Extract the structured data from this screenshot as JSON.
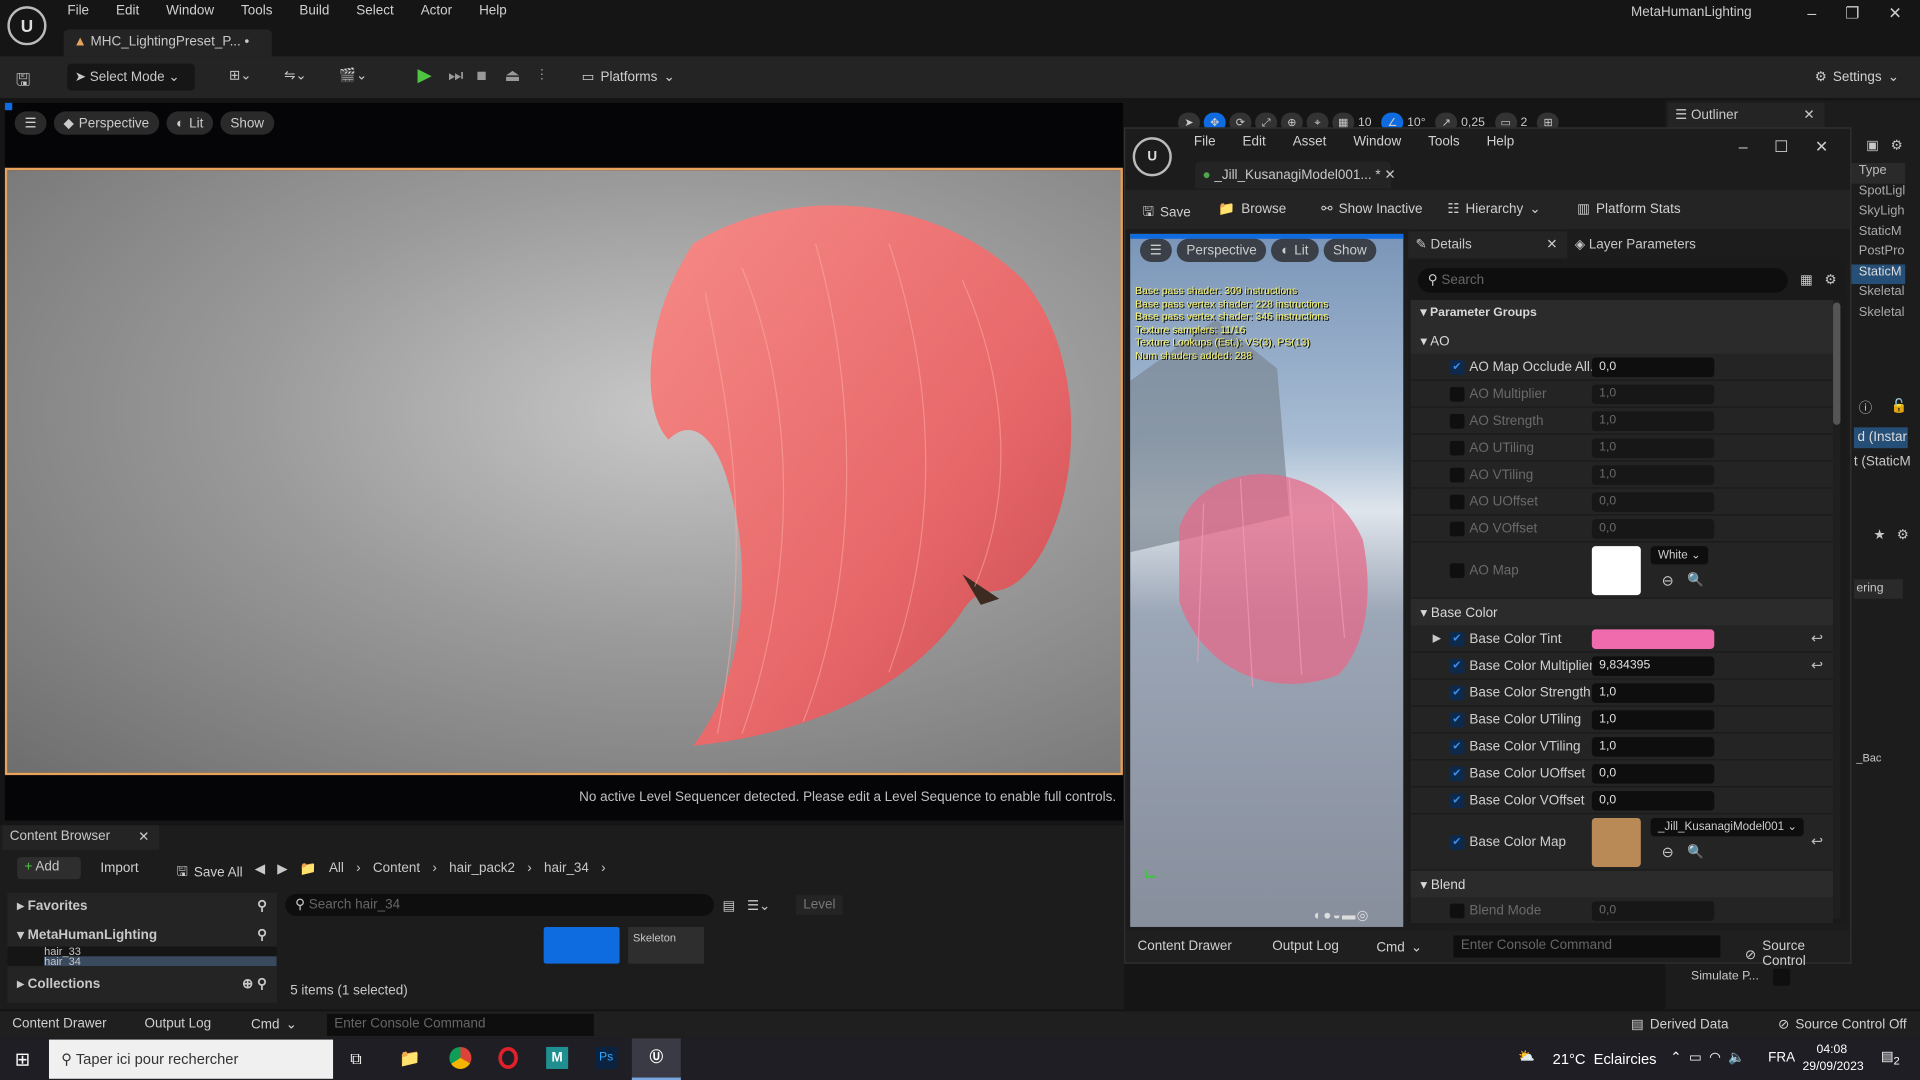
{
  "app": {
    "menus": [
      "File",
      "Edit",
      "Window",
      "Tools",
      "Build",
      "Select",
      "Actor",
      "Help"
    ],
    "project": "MetaHumanLighting",
    "tab": "MHC_LightingPreset_P...",
    "tab_modified": "•"
  },
  "toolbar": {
    "select_mode": "Select Mode",
    "platforms": "Platforms",
    "settings": "Settings"
  },
  "viewport": {
    "perspective": "Perspective",
    "lit": "Lit",
    "show": "Show",
    "grid": "10",
    "angle": "10°",
    "scale": "0,25",
    "camera": "2",
    "sequencer_msg": "No active Level Sequencer detected. Please edit a Level Sequence to enable full controls."
  },
  "outliner": {
    "title": "Outliner",
    "type_header": "Type",
    "types": [
      "SpotLigl",
      "SkyLigh",
      "StaticM",
      "PostPro",
      "StaticM",
      "Skeletal",
      "Skeletal"
    ],
    "selected_index": 4,
    "details_lines": [
      "d (Instar",
      "t (StaticM"
    ],
    "filter": "ering",
    "simulate": "Simulate P...",
    "map_value": "_Bac"
  },
  "editor": {
    "menus": [
      "File",
      "Edit",
      "Asset",
      "Window",
      "Tools",
      "Help"
    ],
    "tab": "_Jill_KusanagiModel001...",
    "tab_modified": "*",
    "save": "Save",
    "browse": "Browse",
    "show_inactive": "Show Inactive",
    "hierarchy": "Hierarchy",
    "platform_stats": "Platform Stats",
    "preview": {
      "perspective": "Perspective",
      "lit": "Lit",
      "show": "Show",
      "stats": [
        "Base pass shader: 309 instructions",
        "Base pass vertex shader: 228 instructions",
        "Base pass vertex shader: 346 instructions",
        "Texture samplers: 11/16",
        "Texture Lookups (Est.): VS(3), PS(13)",
        "Num shaders added: 288"
      ]
    },
    "details_tab": "Details",
    "layer_tab": "Layer Parameters",
    "search_placeholder": "Search",
    "param_groups": "Parameter Groups",
    "groups": [
      {
        "name": "AO",
        "rows": [
          {
            "label": "AO Map Occlude All...",
            "value": "0,0",
            "checked": true,
            "fill": 0
          },
          {
            "label": "AO Multiplier",
            "value": "1,0",
            "checked": false,
            "fill": 0
          },
          {
            "label": "AO Strength",
            "value": "1,0",
            "checked": false,
            "fill": 0
          },
          {
            "label": "AO UTiling",
            "value": "1,0",
            "checked": false,
            "fill": 0
          },
          {
            "label": "AO VTiling",
            "value": "1,0",
            "checked": false,
            "fill": 0
          },
          {
            "label": "AO UOffset",
            "value": "0,0",
            "checked": false,
            "fill": 0.5
          },
          {
            "label": "AO VOffset",
            "value": "0,0",
            "checked": false,
            "fill": 0.5
          },
          {
            "label": "AO Map",
            "type": "texture",
            "texture_name": "White",
            "checked": false,
            "color": "#ffffff"
          }
        ]
      },
      {
        "name": "Base Color",
        "rows": [
          {
            "label": "Base Color Tint",
            "type": "color",
            "color": "#f06aae",
            "checked": true,
            "expand": true,
            "reset": true
          },
          {
            "label": "Base Color Multiplier",
            "value": "9,834395",
            "checked": true,
            "fill": 0,
            "reset": true
          },
          {
            "label": "Base Color Strength",
            "value": "1,0",
            "checked": true,
            "fill": 0
          },
          {
            "label": "Base Color UTiling",
            "value": "1,0",
            "checked": true,
            "fill": 0
          },
          {
            "label": "Base Color VTiling",
            "value": "1,0",
            "checked": true,
            "fill": 0
          },
          {
            "label": "Base Color UOffset",
            "value": "0,0",
            "checked": true,
            "fill": 0.5
          },
          {
            "label": "Base Color VOffset",
            "value": "0,0",
            "checked": true,
            "fill": 0.5
          },
          {
            "label": "Base Color Map",
            "type": "texture",
            "texture_name": "_Jill_KusanagiModel001",
            "checked": true,
            "color": "#b98a55",
            "reset": true
          }
        ]
      },
      {
        "name": "Blend",
        "rows": [
          {
            "label": "Blend Mode",
            "value": "0,0",
            "checked": false,
            "fill": 0
          }
        ]
      }
    ],
    "bottom": {
      "content_drawer": "Content Drawer",
      "output_log": "Output Log",
      "cmd": "Cmd",
      "console_placeholder": "Enter Console Command",
      "source_control": "Source Control"
    }
  },
  "content_browser": {
    "title": "Content Browser",
    "add": "Add",
    "import": "Import",
    "save_all": "Save All",
    "breadcrumb": [
      "All",
      "Content",
      "hair_pack2",
      "hair_34"
    ],
    "favorites": "Favorites",
    "root": "MetaHumanLighting",
    "folders": [
      "hair_33",
      "hair_34"
    ],
    "collections": "Collections",
    "search_placeholder": "Search hair_34",
    "level": "Level",
    "asset_label": "Skeleton",
    "status": "5 items (1 selected)"
  },
  "statusbar": {
    "content_drawer": "Content Drawer",
    "output_log": "Output Log",
    "cmd": "Cmd",
    "console_placeholder": "Enter Console Command",
    "derived_data": "Derived Data",
    "source_control": "Source Control Off"
  },
  "taskbar": {
    "search_placeholder": "Taper ici pour rechercher",
    "weather": "21°C",
    "weather_text": "Eclaircies",
    "lang": "FRA",
    "time": "04:08",
    "date": "29/09/2023",
    "notifications": "2"
  },
  "colors": {
    "accent": "#0e6be0",
    "tint": "#f06aae",
    "viewport_border": "#e7a35c"
  }
}
